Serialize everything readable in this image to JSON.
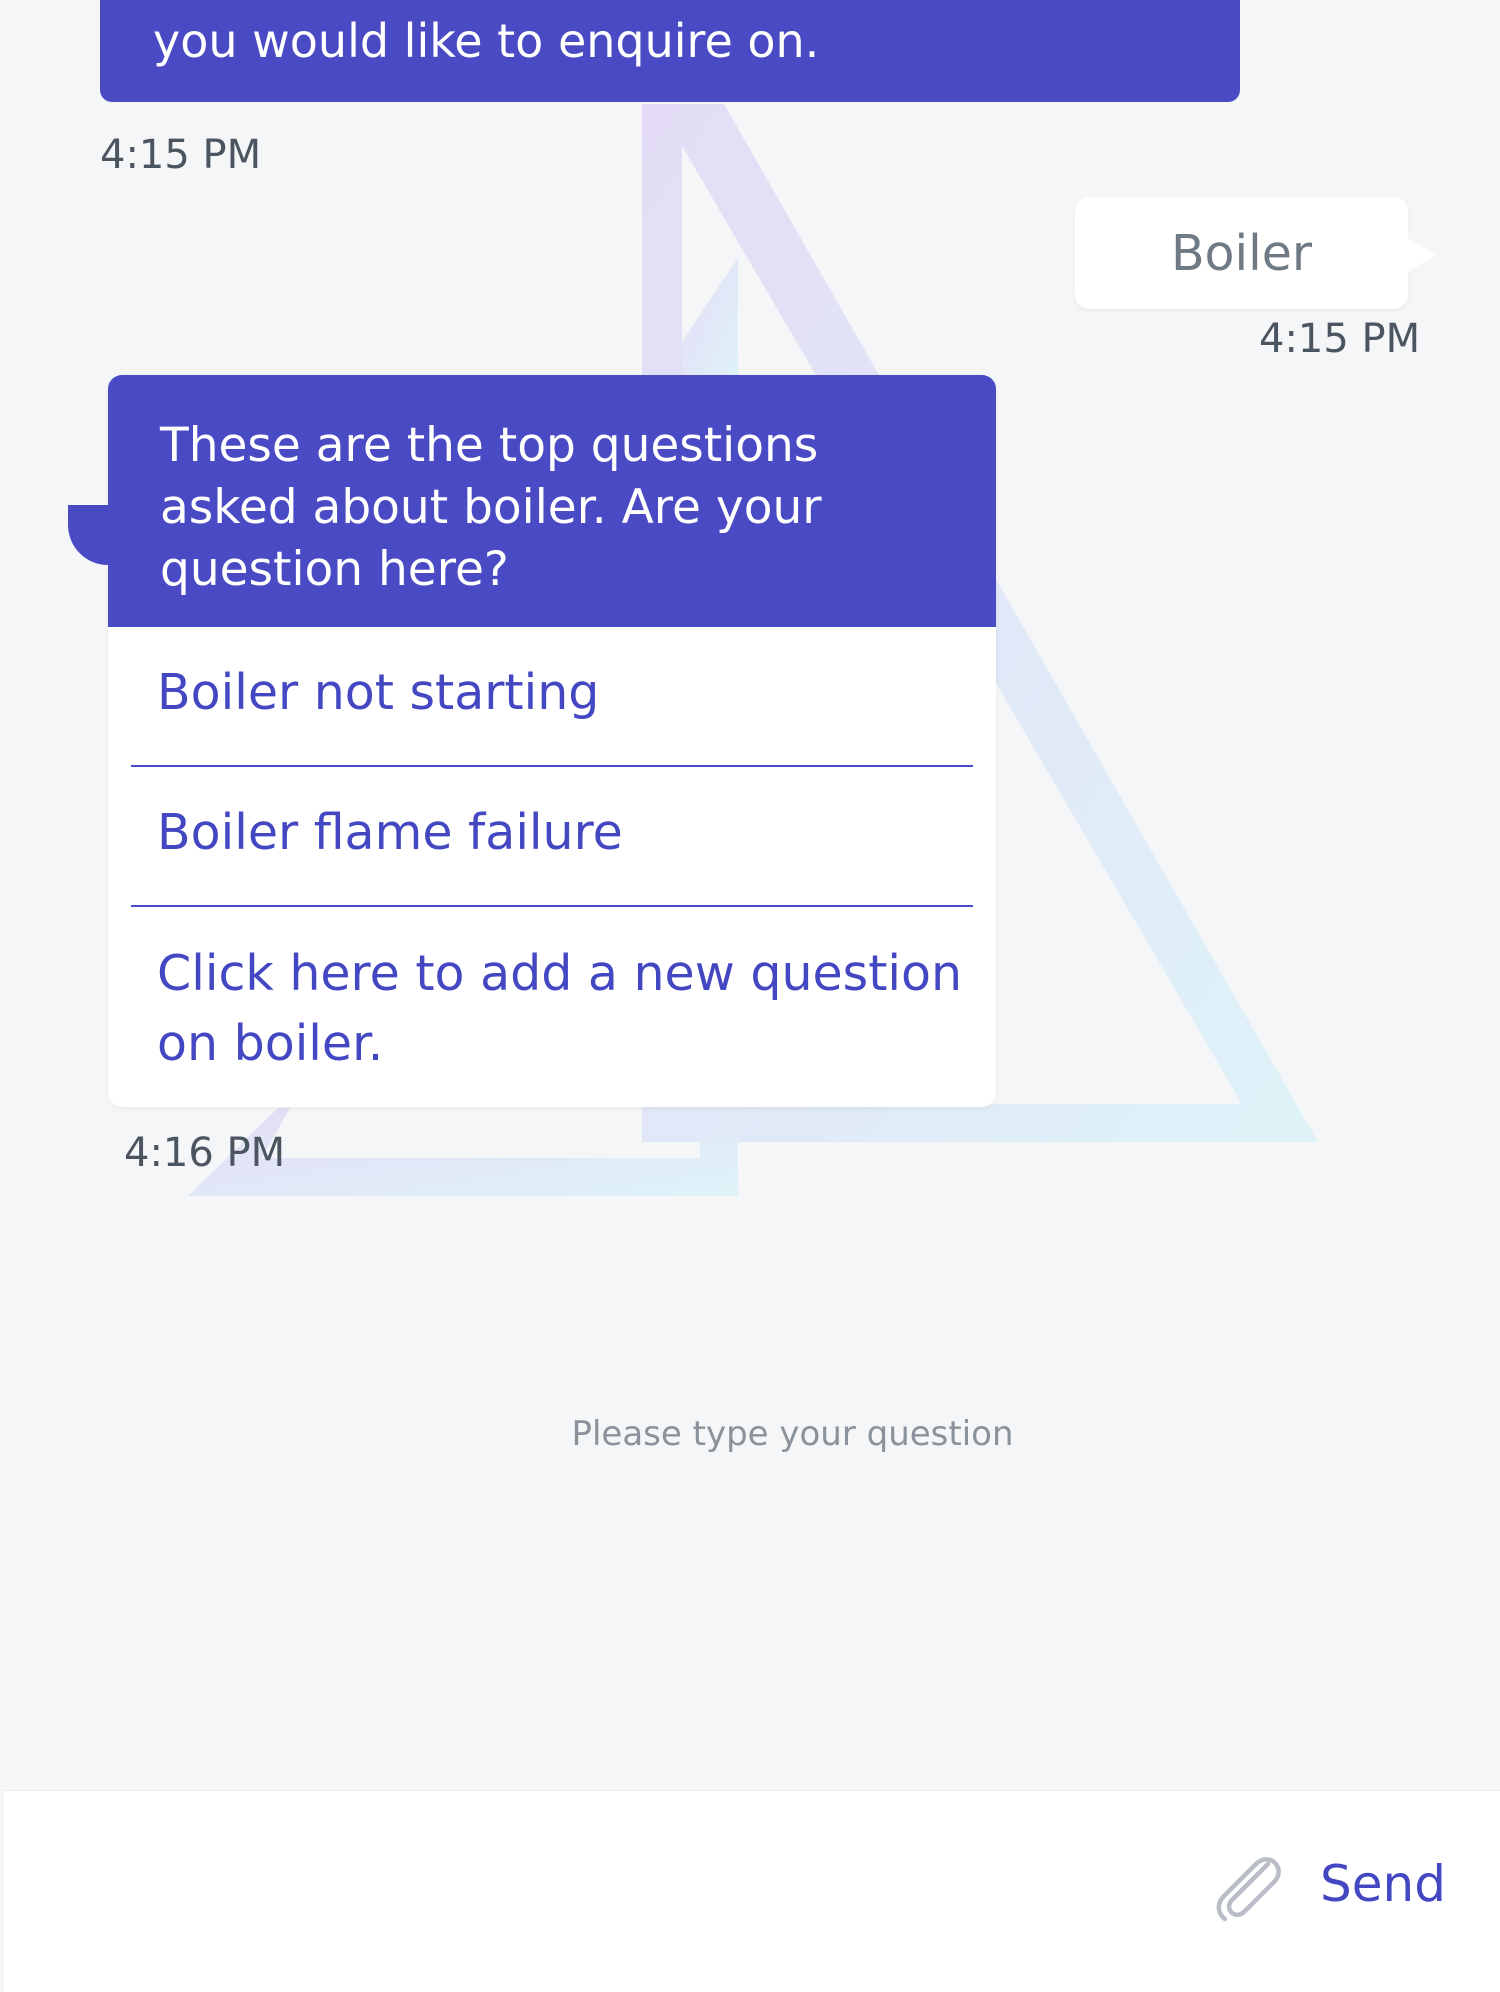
{
  "messages": [
    {
      "sender": "bot",
      "text": "you would like to enquire on.",
      "time": "4:15 PM"
    },
    {
      "sender": "user",
      "text": "Boiler",
      "time": "4:15 PM"
    },
    {
      "sender": "bot",
      "text": "These are the top questions asked about boiler. Are your question here?",
      "options": [
        "Boiler not starting",
        "Boiler flame failure",
        "Click here to add a new question on boiler."
      ],
      "time": "4:16 PM"
    }
  ],
  "composer": {
    "placeholder": "Please type your question",
    "send_label": "Send",
    "attach_icon": "paperclip-icon"
  },
  "colors": {
    "accent": "#4a4bc4",
    "background": "#f5f6f8"
  }
}
